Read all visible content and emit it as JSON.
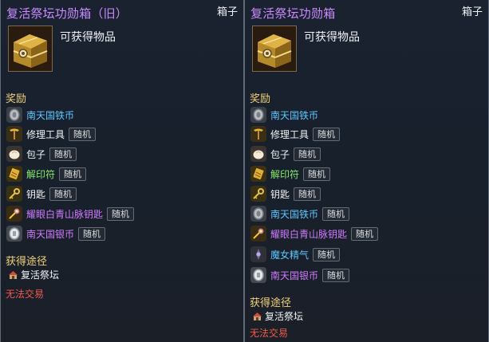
{
  "left_panel": {
    "title": "复活祭坛功勋箱（旧）",
    "type_label": "箱子",
    "item_icon": "treasure-chest-icon",
    "subtitle": "可获得物品",
    "rewards_heading": "奖励",
    "rewards": [
      {
        "name": "南天国铁币",
        "color": "#5ec6ff",
        "icon": "iron-coin-icon",
        "tag": ""
      },
      {
        "name": "修理工具",
        "color": "#f2f3f5",
        "icon": "repair-hammer-icon",
        "tag": "随机"
      },
      {
        "name": "包子",
        "color": "#f2f3f5",
        "icon": "bun-icon",
        "tag": "随机"
      },
      {
        "name": "解印符",
        "color": "#86e86f",
        "icon": "seal-talisman-icon",
        "tag": "随机"
      },
      {
        "name": "钥匙",
        "color": "#f2f3f5",
        "icon": "key-icon",
        "tag": "随机"
      },
      {
        "name": "耀眼白青山脉钥匙",
        "color": "#cf7bff",
        "icon": "radiant-key-icon",
        "tag": "随机"
      },
      {
        "name": "南天国银币",
        "color": "#cf7bff",
        "icon": "silver-coin-icon",
        "tag": "随机"
      }
    ],
    "source_heading": "获得途径",
    "source_icon": "altar-icon",
    "source_text": "复活祭坛",
    "trade_notice": "无法交易"
  },
  "right_panel": {
    "title": "复活祭坛功勋箱",
    "type_label": "箱子",
    "item_icon": "treasure-chest-icon",
    "subtitle": "可获得物品",
    "rewards_heading": "奖励",
    "rewards": [
      {
        "name": "南天国铁币",
        "color": "#5ec6ff",
        "icon": "iron-coin-icon",
        "tag": ""
      },
      {
        "name": "修理工具",
        "color": "#f2f3f5",
        "icon": "repair-hammer-icon",
        "tag": "随机"
      },
      {
        "name": "包子",
        "color": "#f2f3f5",
        "icon": "bun-icon",
        "tag": "随机"
      },
      {
        "name": "解印符",
        "color": "#86e86f",
        "icon": "seal-talisman-icon",
        "tag": "随机"
      },
      {
        "name": "钥匙",
        "color": "#f2f3f5",
        "icon": "key-icon",
        "tag": "随机"
      },
      {
        "name": "南天国铁币",
        "color": "#5ec6ff",
        "icon": "iron-coin-icon",
        "tag": "随机"
      },
      {
        "name": "耀眼白青山脉钥匙",
        "color": "#cf7bff",
        "icon": "radiant-key-icon",
        "tag": "随机"
      },
      {
        "name": "魔女精气",
        "color": "#5ec6ff",
        "icon": "witch-essence-icon",
        "tag": "随机"
      },
      {
        "name": "南天国银币",
        "color": "#cf7bff",
        "icon": "silver-coin-icon",
        "tag": "随机"
      }
    ],
    "source_heading": "获得途径",
    "source_icon": "altar-icon",
    "source_text": "复活祭坛",
    "trade_notice": "无法交易"
  }
}
